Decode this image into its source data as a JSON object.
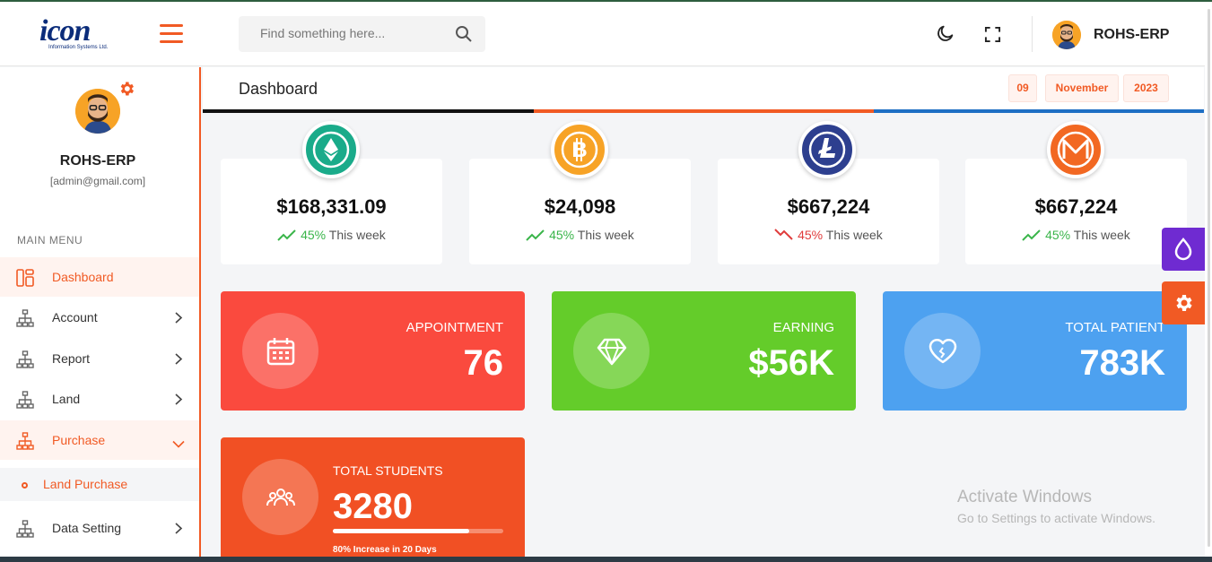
{
  "brand": {
    "logo_text": "icon",
    "logo_sub": "Information Systems Ltd."
  },
  "search": {
    "placeholder": "Find something here..."
  },
  "user": {
    "name": "ROHS-ERP",
    "email": "[admin@gmail.com]"
  },
  "sidebar": {
    "menu_heading": "MAIN MENU",
    "items": [
      {
        "label": "Dashboard",
        "icon": "dashboard-icon",
        "active": true
      },
      {
        "label": "Account",
        "icon": "sitemap-icon"
      },
      {
        "label": "Report",
        "icon": "sitemap-icon"
      },
      {
        "label": "Land",
        "icon": "sitemap-icon"
      },
      {
        "label": "Purchase",
        "icon": "sitemap-icon",
        "expanded": true
      },
      {
        "label": "Data Setting",
        "icon": "sitemap-icon"
      }
    ],
    "submenu": {
      "label": "Land Purchase"
    }
  },
  "header": {
    "title": "Dashboard",
    "date": {
      "day": "09",
      "month": "November",
      "year": "2023"
    }
  },
  "coins": [
    {
      "icon": "ethereum-icon",
      "color": "#1aab8a",
      "value": "$168,331.09",
      "pct": "45%",
      "trend": "up",
      "period": "This week"
    },
    {
      "icon": "bitcoin-icon",
      "color": "#f7a326",
      "value": "$24,098",
      "pct": "45%",
      "trend": "up",
      "period": "This week"
    },
    {
      "icon": "litecoin-icon",
      "color": "#2d3f8f",
      "value": "$667,224",
      "pct": "45%",
      "trend": "down",
      "period": "This week"
    },
    {
      "icon": "monero-icon",
      "color": "#f26822",
      "value": "$667,224",
      "pct": "45%",
      "trend": "up",
      "period": "This week"
    }
  ],
  "stats": [
    {
      "label": "APPOINTMENT",
      "value": "76",
      "color": "#fa4a3e",
      "icon": "calendar-icon"
    },
    {
      "label": "EARNING",
      "value": "$56K",
      "color": "#64cc2a",
      "icon": "diamond-icon"
    },
    {
      "label": "TOTAL PATIENT",
      "value": "783K",
      "color": "#4da1f0",
      "icon": "heart-icon"
    }
  ],
  "students": {
    "label": "TOTAL STUDENTS",
    "value": "3280",
    "progress": 0.8,
    "note": "80% Increase in 20 Days",
    "color": "#f15024"
  },
  "colors": {
    "accent": "#f15a24",
    "purple": "#6f2bd1"
  },
  "watermark": {
    "line1": "Activate Windows",
    "line2": "Go to Settings to activate Windows."
  }
}
